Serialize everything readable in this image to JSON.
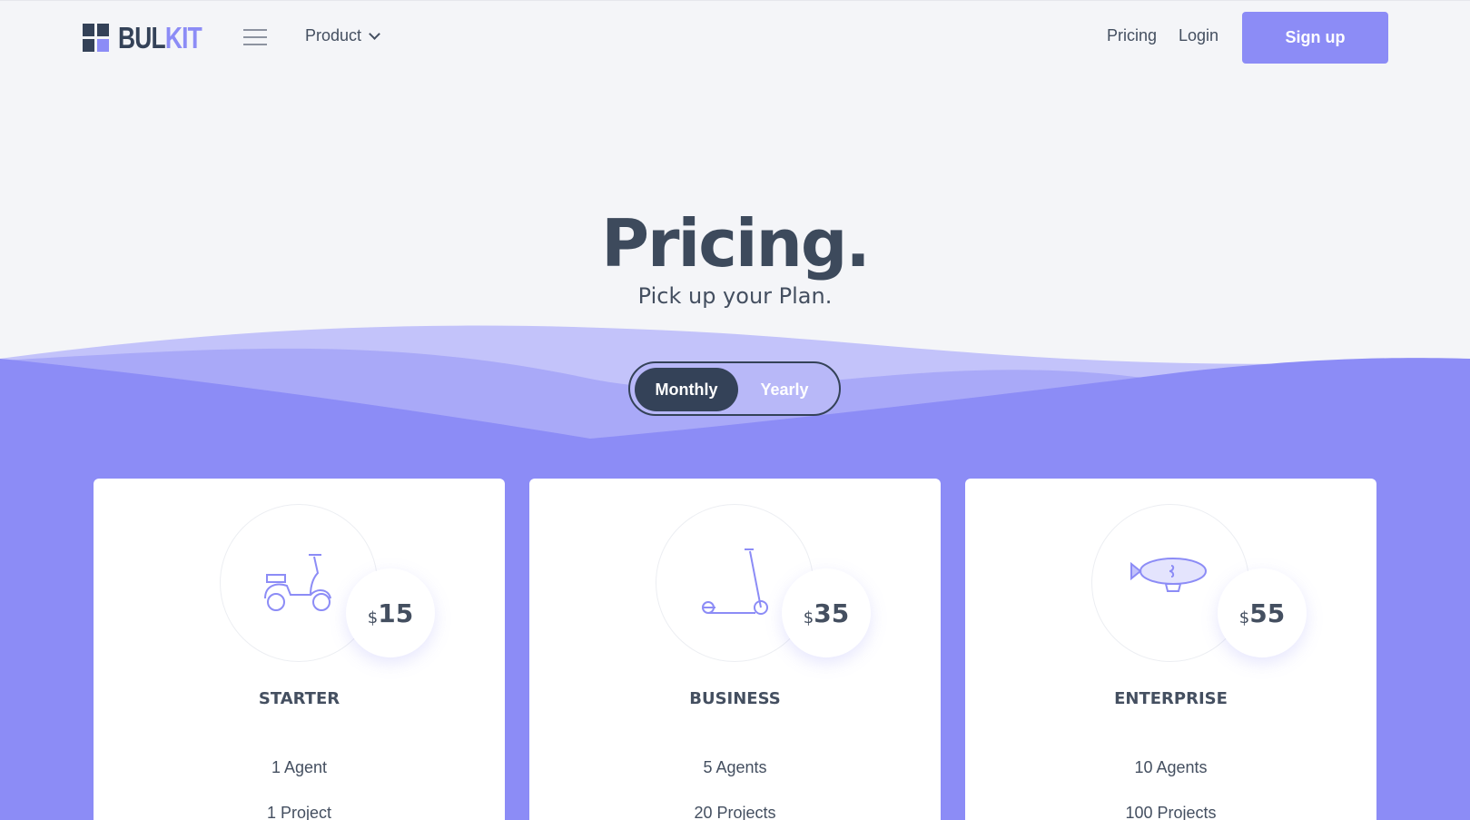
{
  "brand": {
    "logo_part1": "BUL",
    "logo_part2": "KIT"
  },
  "nav": {
    "product_label": "Product",
    "pricing_label": "Pricing",
    "login_label": "Login",
    "signup_label": "Sign up"
  },
  "hero": {
    "title": "Pricing.",
    "subtitle": "Pick up your Plan."
  },
  "billing_toggle": {
    "monthly_label": "Monthly",
    "yearly_label": "Yearly",
    "selected": "Monthly"
  },
  "plans": [
    {
      "name": "STARTER",
      "currency": "$",
      "price": "15",
      "icon": "scooter-icon",
      "features": [
        "1 Agent",
        "1 Project"
      ]
    },
    {
      "name": "BUSINESS",
      "currency": "$",
      "price": "35",
      "icon": "kick-scooter-icon",
      "features": [
        "5 Agents",
        "20 Projects"
      ]
    },
    {
      "name": "ENTERPRISE",
      "currency": "$",
      "price": "55",
      "icon": "airship-icon",
      "features": [
        "10 Agents",
        "100 Projects"
      ]
    }
  ],
  "colors": {
    "accent": "#8c8cf6",
    "dark": "#344258",
    "background": "#f4f5f8",
    "text": "#444f60"
  }
}
